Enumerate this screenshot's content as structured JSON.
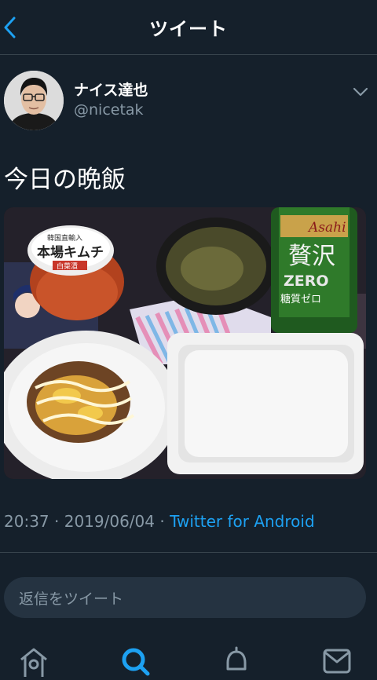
{
  "header": {
    "back_icon": "chevron-left-icon",
    "title": "ツイート"
  },
  "tweet": {
    "author": {
      "display_name": "ナイス達也",
      "handle": "@nicetak"
    },
    "text": "今日の晩飯",
    "media": {
      "labels": {
        "kimchi_brand": "韓国直輸入",
        "kimchi_name": "本場キムチ",
        "kimchi_sub": "白菜漬",
        "can_brand": "Asahi",
        "can_big": "贅沢",
        "can_zero": "ZERO",
        "can_sub": "糖質ゼロ"
      }
    },
    "meta": {
      "time": "20:37",
      "date": "2019/06/04",
      "separator": " · ",
      "source": "Twitter for Android"
    }
  },
  "reply": {
    "placeholder": "返信をツイート"
  },
  "tabs": [
    {
      "icon": "home-icon"
    },
    {
      "icon": "search-icon",
      "active": true
    },
    {
      "icon": "bell-icon"
    },
    {
      "icon": "mail-icon"
    }
  ],
  "colors": {
    "background": "#15202b",
    "accent": "#1da1f2",
    "muted": "#8899a6",
    "divider": "#38444d"
  }
}
